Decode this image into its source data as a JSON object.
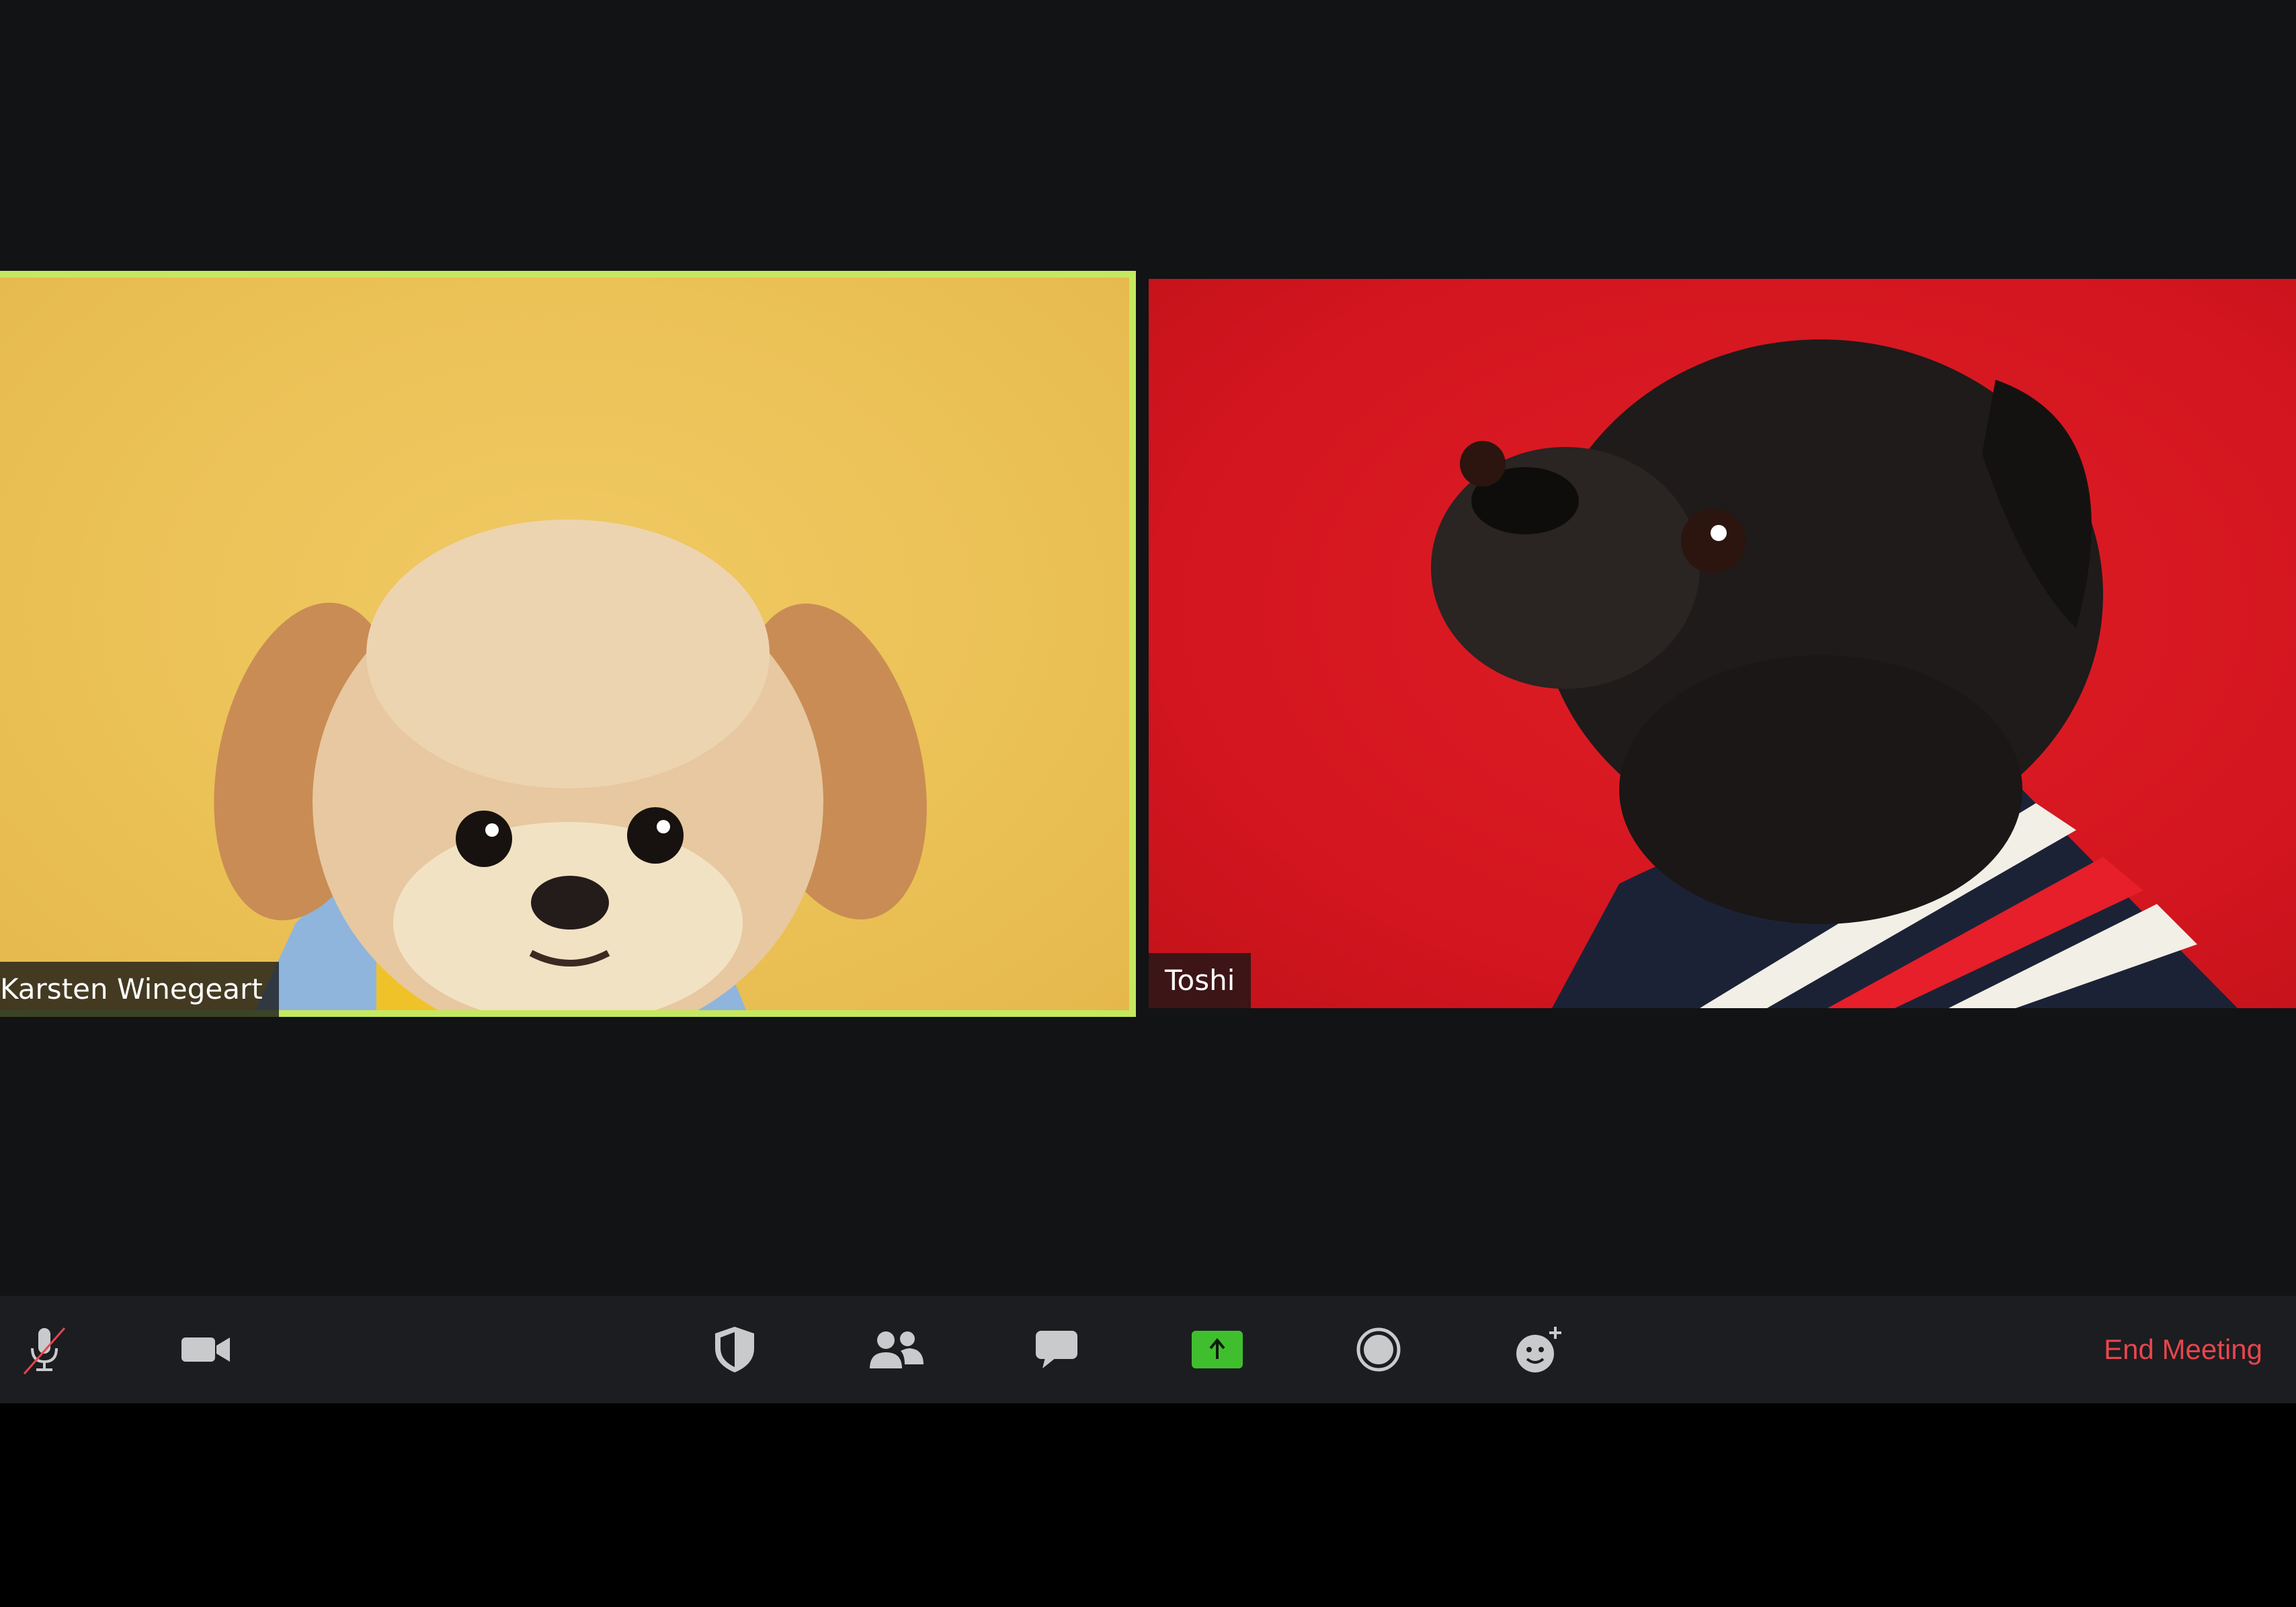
{
  "participants": [
    {
      "name": "Karsten Winegeart",
      "active_speaker": true
    },
    {
      "name": "Toshi",
      "active_speaker": false
    }
  ],
  "toolbar": {
    "buttons": [
      {
        "icon": "mic-muted-icon"
      },
      {
        "icon": "video-camera-icon"
      },
      {
        "icon": "security-shield-icon"
      },
      {
        "icon": "participants-icon"
      },
      {
        "icon": "chat-icon"
      },
      {
        "icon": "share-screen-icon"
      },
      {
        "icon": "record-icon"
      },
      {
        "icon": "reactions-icon"
      }
    ],
    "end_meeting_label": "End Meeting"
  },
  "colors": {
    "stage_background": "#121315",
    "toolbar_background": "#1b1d20",
    "active_speaker_border": "#c5e860",
    "share_green": "#3fbf2e",
    "end_meeting_red": "#e8454d",
    "left_video_background": "#e9bd52",
    "right_video_background": "#d2151f"
  }
}
